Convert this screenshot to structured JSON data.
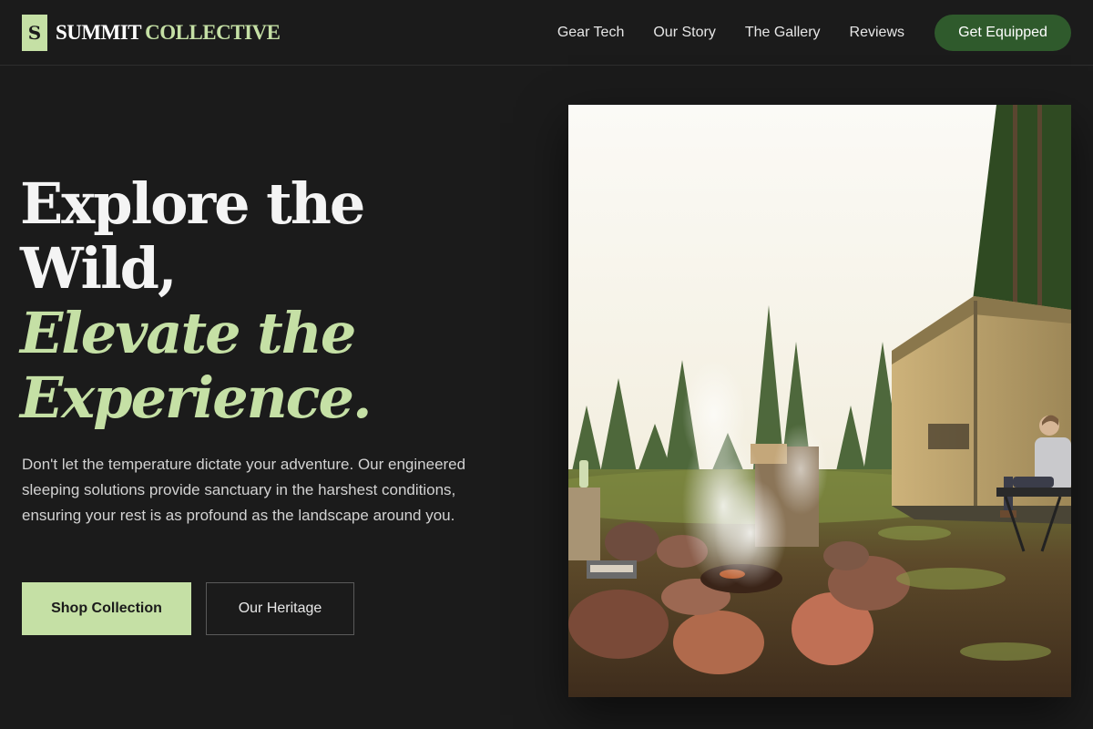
{
  "header": {
    "logo_badge": "S",
    "logo_word1": "SUMMIT",
    "logo_word2": "COLLECTIVE",
    "nav": [
      {
        "label": "Gear Tech"
      },
      {
        "label": "Our Story"
      },
      {
        "label": "The Gallery"
      },
      {
        "label": "Reviews"
      }
    ],
    "cta_label": "Get Equipped"
  },
  "hero": {
    "headline_line1": "Explore the",
    "headline_line2": "Wild,",
    "headline_line3": "Elevate the",
    "headline_line4": "Experience.",
    "description": "Don't let the temperature dictate your adventure. Our engineered sleeping solutions provide sanctuary in the harshest conditions, ensuring your rest is as profound as the landscape around you.",
    "primary_button": "Shop Collection",
    "secondary_button": "Our Heritage"
  },
  "colors": {
    "background": "#1b1b1b",
    "accent": "#c5e0a5",
    "cta_green": "#2f5a2c"
  }
}
